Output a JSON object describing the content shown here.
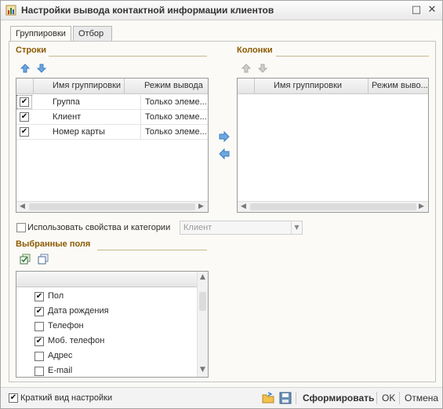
{
  "window": {
    "title": "Настройки вывода контактной информации клиентов",
    "buttons": {
      "maximize": "□",
      "close": "✕"
    }
  },
  "tabs": [
    {
      "label": "Группировки",
      "active": true
    },
    {
      "label": "Отбор",
      "active": false
    }
  ],
  "rows_section": {
    "title": "Строки",
    "columns": [
      "Имя группировки",
      "Режим вывода"
    ],
    "items": [
      {
        "checked": true,
        "name": "Группа",
        "mode": "Только элеме..."
      },
      {
        "checked": true,
        "name": "Клиент",
        "mode": "Только элеме..."
      },
      {
        "checked": true,
        "name": "Номер карты",
        "mode": "Только элеме..."
      }
    ]
  },
  "columns_section": {
    "title": "Колонки",
    "columns": [
      "Имя группировки",
      "Режим выво..."
    ]
  },
  "properties": {
    "checkbox_label": "Использовать свойства и категории",
    "checked": false,
    "combo_value": "Клиент"
  },
  "selected_fields": {
    "title": "Выбранные поля",
    "items": [
      {
        "checked": true,
        "label": "Пол"
      },
      {
        "checked": true,
        "label": "Дата рождения"
      },
      {
        "checked": false,
        "label": "Телефон"
      },
      {
        "checked": true,
        "label": "Моб. телефон"
      },
      {
        "checked": false,
        "label": "Адрес"
      },
      {
        "checked": false,
        "label": "E-mail"
      }
    ]
  },
  "footer": {
    "short_view_label": "Краткий вид настройки",
    "short_view_checked": true,
    "generate_label": "Сформировать",
    "ok_label": "OK",
    "cancel_label": "Отмена"
  },
  "colors": {
    "section_title": "#8b5a00",
    "arrow_blue": "#3a7fc6",
    "arrow_green": "#3f8f3f"
  }
}
